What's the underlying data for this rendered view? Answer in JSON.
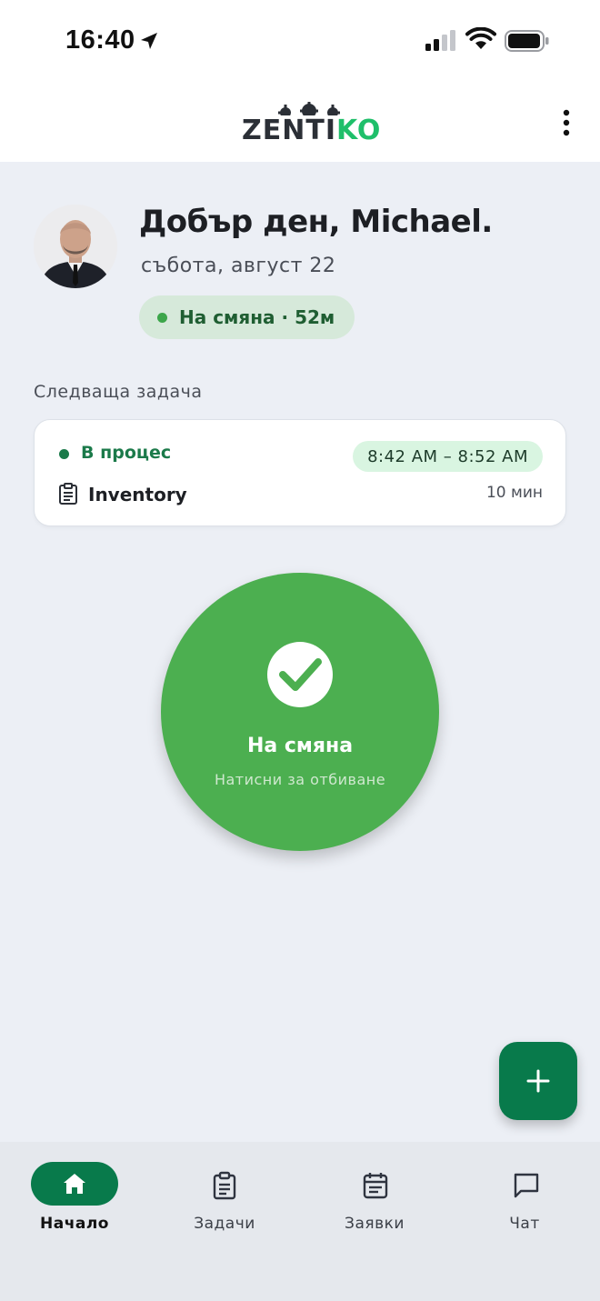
{
  "status_bar": {
    "time": "16:40"
  },
  "header": {
    "logo_dark": "ZENTI",
    "logo_green": "KO",
    "brand_color": "#1fbf6a"
  },
  "user": {
    "greeting": "Добър ден, Michael.",
    "date": "събота, август 22"
  },
  "shift_status": {
    "label": "На смяна · 52м",
    "color": "#3ca64a"
  },
  "next_task": {
    "section_label": "Следваща задача",
    "status": "В процес",
    "time_range": "8:42 AM – 8:52 AM",
    "name": "Inventory",
    "duration": "10 мин"
  },
  "clock_button": {
    "title": "На смяна",
    "subtitle": "Натисни за отбиване",
    "color": "#4caf50"
  },
  "fab": {
    "icon": "plus-icon",
    "color": "#087a4b"
  },
  "bottom_nav": {
    "items": [
      {
        "label": "Начало",
        "icon": "home-icon",
        "active": true
      },
      {
        "label": "Задачи",
        "icon": "clipboard-icon",
        "active": false
      },
      {
        "label": "Заявки",
        "icon": "calendar-icon",
        "active": false
      },
      {
        "label": "Чат",
        "icon": "chat-icon",
        "active": false
      }
    ]
  }
}
